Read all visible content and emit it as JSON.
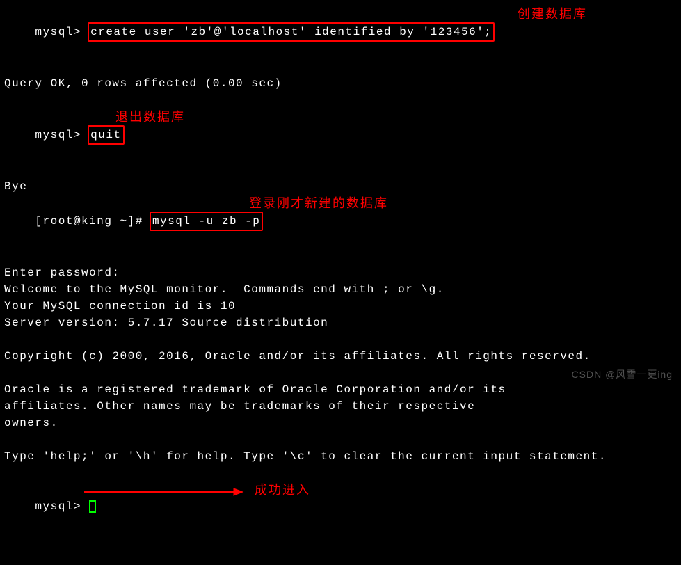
{
  "lines": {
    "l1_prompt": "mysql> ",
    "l1_cmd": "create user 'zb'@'localhost' identified by '123456';",
    "l2": "Query OK, 0 rows affected (0.00 sec)",
    "l3_prompt": "mysql> ",
    "l3_cmd": "quit",
    "l4": "Bye",
    "l5_prompt": "[root@king ~]# ",
    "l5_cmd": "mysql -u zb -p",
    "l6": "Enter password:",
    "l7": "Welcome to the MySQL monitor.  Commands end with ; or \\g.",
    "l8": "Your MySQL connection id is 10",
    "l9": "Server version: 5.7.17 Source distribution",
    "l10": "Copyright (c) 2000, 2016, Oracle and/or its affiliates. All rights reserved.",
    "l11": "Oracle is a registered trademark of Oracle Corporation and/or its",
    "l12": "affiliates. Other names may be trademarks of their respective",
    "l13": "owners.",
    "l14": "Type 'help;' or '\\h' for help. Type '\\c' to clear the current input statement.",
    "l15_prompt": "mysql> "
  },
  "annotations": {
    "a1": "创建数据库",
    "a2": "退出数据库",
    "a3": "登录刚才新建的数据库",
    "a4": "成功进入"
  },
  "watermark": "CSDN @风雪一更ing"
}
